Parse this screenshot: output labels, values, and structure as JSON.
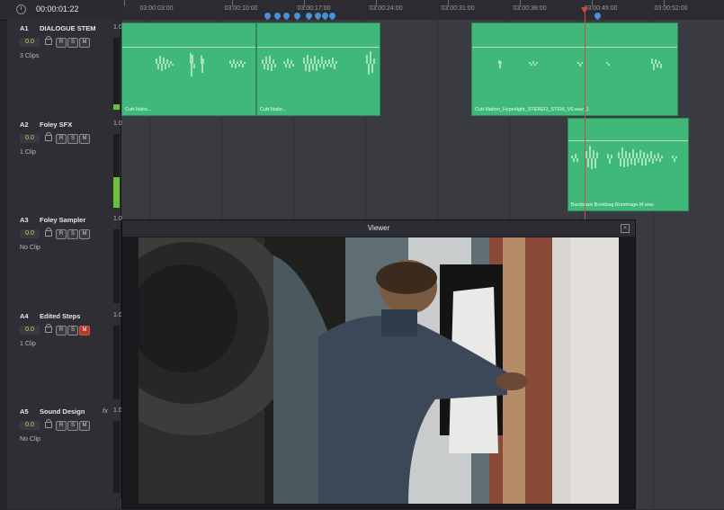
{
  "header": {
    "timecode": "00:00:01:22"
  },
  "ruler": {
    "ticks": [
      "03:00:03:00",
      "03:00:10:00",
      "03:00:17:00",
      "03:00:24:00",
      "03:00:31:00",
      "03:00:38:00",
      "03:00:45:00",
      "03:00:52:00"
    ]
  },
  "tracks": [
    {
      "id": "A1",
      "name": "DIALOGUE STEM",
      "level": "1.0",
      "volume": "0.0",
      "clips": "3 Clips",
      "lock": "L",
      "rec": "R",
      "solo": "S",
      "mute": "M",
      "meter": 0.08
    },
    {
      "id": "A2",
      "name": "Foley SFX",
      "level": "1.0",
      "volume": "0.0",
      "clips": "1 Clip",
      "lock": "L",
      "rec": "R",
      "solo": "S",
      "mute": "M",
      "meter": 0.42
    },
    {
      "id": "A3",
      "name": "Foley Sampler",
      "level": "1.0",
      "volume": "0.0",
      "clips": "No Clip",
      "lock": "L",
      "rec": "R",
      "solo": "S",
      "mute": "M",
      "meter": 0
    },
    {
      "id": "A4",
      "name": "Edited Steps",
      "level": "1.0",
      "volume": "0.0",
      "clips": "1 Clip",
      "lock": "L",
      "rec": "R",
      "solo": "S",
      "mute": "M",
      "meter": 0
    },
    {
      "id": "A5",
      "name": "Sound Design",
      "level": "1.0",
      "fx": "fx",
      "volume": "0.0",
      "clips": "No Clip",
      "lock": "L",
      "rec": "R",
      "solo": "S",
      "mute": "M",
      "meter": 0
    }
  ],
  "clips": {
    "a1_1": "Cutt-Natio...",
    "a1_2": "Cutt-Natio...",
    "a1_3": "Cutt-Nation_Hyperlight_STEREO_STEM_V0.wav_1",
    "a2_1": "Backtrack Bookbag Rummage.M.wav"
  },
  "viewer": {
    "title": "Viewer",
    "close": "✕"
  },
  "colors": {
    "clip": "#3fb87a",
    "playhead": "#c8503a",
    "marker": "#4a90d9",
    "meter": "#6bc03a",
    "mute_on": "#b33a2e"
  }
}
